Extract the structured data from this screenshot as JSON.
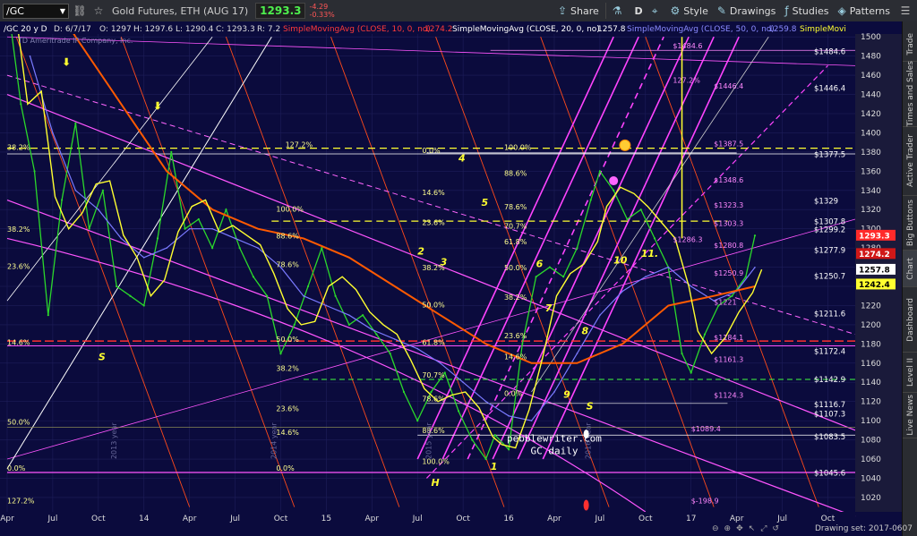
{
  "topbar": {
    "symbol": "/GC",
    "description": "Gold Futures, ETH (AUG 17)",
    "last": "1293.3",
    "change": "-4.29",
    "change_pct": "-0.33%",
    "buttons": {
      "share": "Share",
      "style": "Style",
      "drawings": "Drawings",
      "studies": "Studies",
      "patterns": "Patterns"
    },
    "period_letter": "D"
  },
  "right_tabs": [
    "Trade",
    "Times and Sales",
    "Active Trader",
    "Big Buttons",
    "Chart",
    "Dashboard",
    "Level II",
    "Live News"
  ],
  "status_line": {
    "symbol": "/GC 20 y D",
    "date": "D: 6/7/17",
    "open": "O: 1297",
    "high": "H: 1297.6",
    "low": "L: 1290.4",
    "close": "C: 1293.3",
    "range": "R: 7.2",
    "study1": "SimpleMovingAvg (CLOSE, 10, 0, no)",
    "study1_val": "1274.2",
    "study2": "SimpleMovingAvg (CLOSE, 20, 0, no)",
    "study2_val": "1257.8",
    "study3": "SimpleMovingAvg (CLOSE, 50, 0, no)",
    "study3_val": "1259.8",
    "study4": "SimpleMovi"
  },
  "watermark": "TD Ameritrade IP Company, Inc.",
  "drawing_set": "Drawing set: 2017-0607",
  "colors": {
    "bg": "#0b0b3d",
    "price": "#2bd82b",
    "sma10": "#ff2a2a",
    "sma20": "#7a7aff",
    "sma50": "#ffff30",
    "sma200": "#ff5a00",
    "fib": "#ff55ff",
    "yellow": "#ffff00",
    "white": "#ffffff"
  },
  "chart_data": {
    "type": "line",
    "title": "",
    "xlabel": "",
    "ylabel": "",
    "ylim": [
      1005,
      1503
    ],
    "y_ticks": [
      1020,
      1040,
      1060,
      1080,
      1100,
      1120,
      1140,
      1160,
      1180,
      1200,
      1220,
      1240,
      1260,
      1280,
      1300,
      1320,
      1340,
      1360,
      1380,
      1400,
      1420,
      1440,
      1460,
      1480,
      1500
    ],
    "x_ticks": [
      "Apr",
      "Jul",
      "Oct",
      "14",
      "Apr",
      "Jul",
      "Oct",
      "15",
      "Apr",
      "Jul",
      "Oct",
      "16",
      "Apr",
      "Jul",
      "Oct",
      "17",
      "Apr",
      "Jul",
      "Oct"
    ],
    "x_tick_t": [
      0,
      1,
      2,
      3,
      4,
      5,
      6,
      7,
      8,
      9,
      10,
      11,
      12,
      13,
      14,
      15,
      16,
      17,
      18
    ],
    "series": [
      {
        "t": [
          0,
          0.3,
          0.6,
          0.9,
          1.2,
          1.5,
          1.8,
          2.1,
          2.4,
          2.7,
          3,
          3.3,
          3.6,
          3.9,
          4.2,
          4.5,
          4.8,
          5.1,
          5.4,
          5.7,
          6,
          6.3,
          6.6,
          6.9,
          7.2,
          7.5,
          7.8,
          8.1,
          8.4,
          8.7,
          9,
          9.3,
          9.6,
          9.9,
          10.2,
          10.5,
          10.7,
          11,
          11.3,
          11.6,
          11.9,
          12.2,
          12.5,
          12.8,
          13,
          13.3,
          13.6,
          13.9,
          14.2,
          14.5,
          14.8,
          15,
          15.3,
          15.6,
          15.9,
          16.2,
          16.4
        ],
        "values": [
          1540,
          1430,
          1360,
          1210,
          1330,
          1410,
          1300,
          1340,
          1240,
          1230,
          1220,
          1290,
          1380,
          1300,
          1310,
          1280,
          1320,
          1280,
          1250,
          1230,
          1170,
          1200,
          1240,
          1280,
          1230,
          1200,
          1210,
          1190,
          1170,
          1130,
          1100,
          1130,
          1150,
          1110,
          1080,
          1060,
          1085,
          1070,
          1180,
          1250,
          1260,
          1250,
          1280,
          1330,
          1360,
          1340,
          1310,
          1320,
          1290,
          1260,
          1170,
          1150,
          1190,
          1220,
          1230,
          1250,
          1293
        ]
      },
      {
        "t": [
          0.5,
          1,
          1.5,
          2,
          2.5,
          3,
          3.5,
          4,
          4.5,
          5,
          5.5,
          6,
          6.5,
          7,
          7.5,
          8,
          8.5,
          9,
          9.5,
          10,
          10.5,
          11,
          11.5,
          12,
          12.5,
          13,
          13.5,
          14,
          14.5,
          15,
          15.5,
          16,
          16.4
        ],
        "values": [
          1480,
          1400,
          1340,
          1320,
          1290,
          1270,
          1280,
          1300,
          1300,
          1290,
          1280,
          1260,
          1230,
          1220,
          1210,
          1195,
          1185,
          1175,
          1160,
          1140,
          1120,
          1105,
          1100,
          1130,
          1170,
          1210,
          1235,
          1250,
          1260,
          1240,
          1225,
          1235,
          1259.8
        ]
      },
      {
        "t": [
          0.5,
          1.5,
          2.5,
          3.5,
          4.5,
          5.5,
          6.5,
          7.5,
          8.5,
          9.5,
          10.5,
          11.5,
          12.5,
          13.5,
          14.5,
          15.5,
          16.4
        ],
        "values": [
          1580,
          1500,
          1430,
          1360,
          1320,
          1300,
          1290,
          1270,
          1240,
          1210,
          1180,
          1160,
          1160,
          1180,
          1220,
          1230,
          1240
        ]
      }
    ],
    "price_tags": [
      {
        "v": 1484.6,
        "label": "$1484.6"
      },
      {
        "v": 1446.4,
        "label": "$1446.4"
      },
      {
        "v": 1377.5,
        "label": "$1377.5"
      },
      {
        "v": 1329,
        "label": "$1329"
      },
      {
        "v": 1307.8,
        "label": "$1307.8"
      },
      {
        "v": 1299.2,
        "label": "$1299.2"
      },
      {
        "v": 1277.9,
        "label": "$1277.9"
      },
      {
        "v": 1250.7,
        "label": "$1250.7"
      },
      {
        "v": 1211.6,
        "label": "$1211.6"
      },
      {
        "v": 1172.4,
        "label": "$1172.4"
      },
      {
        "v": 1142.9,
        "label": "$1142.9"
      },
      {
        "v": 1116.7,
        "label": "$1116.7"
      },
      {
        "v": 1107.3,
        "label": "$1107.3"
      },
      {
        "v": 1083.5,
        "label": "$1083.5"
      },
      {
        "v": 1045.6,
        "label": "$1045.6"
      }
    ],
    "fib_labels": [
      {
        "t": 14.6,
        "v": 1488,
        "label": "$1484.6"
      },
      {
        "t": 14.6,
        "v": 1452,
        "label": "127.2%"
      },
      {
        "t": 15.5,
        "v": 1446,
        "label": "$1446.4"
      },
      {
        "t": 15.5,
        "v": 1386,
        "label": "$1387.5"
      },
      {
        "t": 15.5,
        "v": 1348,
        "label": "$1348.6"
      },
      {
        "t": 15.5,
        "v": 1322,
        "label": "$1323.3"
      },
      {
        "t": 15.5,
        "v": 1303,
        "label": "$1303.3"
      },
      {
        "t": 14.6,
        "v": 1286,
        "label": "$1286.3"
      },
      {
        "t": 15.5,
        "v": 1280,
        "label": "$1280.8"
      },
      {
        "t": 15.5,
        "v": 1251,
        "label": "$1250.9"
      },
      {
        "t": 15.5,
        "v": 1221,
        "label": "$1221"
      },
      {
        "t": 15.5,
        "v": 1184,
        "label": "$1184.1"
      },
      {
        "t": 15.5,
        "v": 1161,
        "label": "$1161.3"
      },
      {
        "t": 15.5,
        "v": 1124,
        "label": "$1124.3"
      },
      {
        "t": 15.0,
        "v": 1089,
        "label": "$1089.4"
      },
      {
        "t": 15.0,
        "v": 1014,
        "label": "$-198.9"
      }
    ],
    "pct_labels": [
      {
        "t": 9.1,
        "v": 1379,
        "label": "0.0%"
      },
      {
        "t": 9.1,
        "v": 1335,
        "label": "14.6%"
      },
      {
        "t": 9.1,
        "v": 1304,
        "label": "23.6%"
      },
      {
        "t": 9.1,
        "v": 1257,
        "label": "38.2%"
      },
      {
        "t": 9.1,
        "v": 1218,
        "label": "50.0%"
      },
      {
        "t": 9.1,
        "v": 1179,
        "label": "61.8%"
      },
      {
        "t": 9.1,
        "v": 1145,
        "label": "70.7%"
      },
      {
        "t": 9.1,
        "v": 1120,
        "label": "78.6%"
      },
      {
        "t": 9.1,
        "v": 1087,
        "label": "88.6%"
      },
      {
        "t": 9.1,
        "v": 1055,
        "label": "100.0%"
      },
      {
        "t": 10.9,
        "v": 1355,
        "label": "88.6%"
      },
      {
        "t": 10.9,
        "v": 1320,
        "label": "78.6%"
      },
      {
        "t": 10.9,
        "v": 1300,
        "label": "70.7%"
      },
      {
        "t": 10.9,
        "v": 1284,
        "label": "61.8%"
      },
      {
        "t": 10.9,
        "v": 1257,
        "label": "50.0%"
      },
      {
        "t": 10.9,
        "v": 1226,
        "label": "38.2%"
      },
      {
        "t": 10.9,
        "v": 1186,
        "label": "23.6%"
      },
      {
        "t": 10.9,
        "v": 1164,
        "label": "14.6%"
      },
      {
        "t": 10.9,
        "v": 1126,
        "label": "0.0%"
      },
      {
        "t": 10.9,
        "v": 1382,
        "label": "100.0%"
      },
      {
        "t": 0.0,
        "v": 1382,
        "label": "38.2%"
      },
      {
        "t": 0.0,
        "v": 1297,
        "label": "38.2%"
      },
      {
        "t": 0.0,
        "v": 1258,
        "label": "23.6%"
      },
      {
        "t": 0.0,
        "v": 1179,
        "label": "14.6%"
      },
      {
        "t": 0.0,
        "v": 1096,
        "label": "50.0%"
      },
      {
        "t": 0.0,
        "v": 1048,
        "label": "0.0%"
      },
      {
        "t": 0.0,
        "v": 1014,
        "label": "127.2%"
      },
      {
        "t": 5.9,
        "v": 1318,
        "label": "100.0%"
      },
      {
        "t": 5.9,
        "v": 1290,
        "label": "88.6%"
      },
      {
        "t": 5.9,
        "v": 1260,
        "label": "78.6%"
      },
      {
        "t": 5.9,
        "v": 1182,
        "label": "50.0%"
      },
      {
        "t": 5.9,
        "v": 1152,
        "label": "38.2%"
      },
      {
        "t": 5.9,
        "v": 1110,
        "label": "23.6%"
      },
      {
        "t": 5.9,
        "v": 1085,
        "label": "14.6%"
      },
      {
        "t": 5.9,
        "v": 1048,
        "label": "0.0%"
      },
      {
        "t": 6.1,
        "v": 1385,
        "label": "127.2%"
      }
    ],
    "wave_labels": [
      {
        "t": 10.6,
        "v": 1049,
        "label": "1"
      },
      {
        "t": 9.0,
        "v": 1273,
        "label": "2"
      },
      {
        "t": 9.5,
        "v": 1262,
        "label": "3"
      },
      {
        "t": 9.9,
        "v": 1370,
        "label": "4"
      },
      {
        "t": 10.4,
        "v": 1324,
        "label": "5"
      },
      {
        "t": 11.6,
        "v": 1260,
        "label": "6"
      },
      {
        "t": 11.8,
        "v": 1214,
        "label": "7"
      },
      {
        "t": 12.6,
        "v": 1190,
        "label": "8"
      },
      {
        "t": 12.2,
        "v": 1124,
        "label": "9"
      },
      {
        "t": 13.3,
        "v": 1264,
        "label": "10"
      },
      {
        "t": 13.9,
        "v": 1271,
        "label": "11."
      },
      {
        "t": 2.0,
        "v": 1163,
        "label": "S"
      },
      {
        "t": 12.7,
        "v": 1112,
        "label": "S"
      },
      {
        "t": 9.3,
        "v": 1032,
        "label": "H"
      }
    ],
    "annotation": [
      "pebblewriter.com",
      "GC daily"
    ],
    "axis_tags": [
      {
        "v": 1293.3,
        "label": "1293.3",
        "color": "#ff2a2a"
      },
      {
        "v": 1274.2,
        "label": "1274.2",
        "color": "#d01818"
      },
      {
        "v": 1257.8,
        "label": "1257.8",
        "color": "#ffffff"
      },
      {
        "v": 1242.4,
        "label": "1242.4",
        "color": "#ffff30"
      }
    ],
    "year_labels": [
      {
        "t": 2.4,
        "label": "2013 year"
      },
      {
        "t": 5.9,
        "label": "2014 year"
      },
      {
        "t": 9.3,
        "label": "2015 year"
      },
      {
        "t": 12.8,
        "label": "2016 year"
      }
    ]
  }
}
